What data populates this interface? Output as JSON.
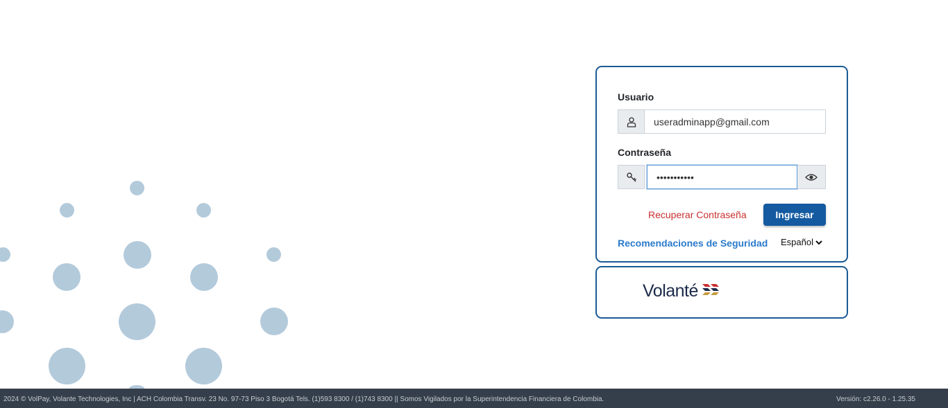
{
  "login": {
    "username_label": "Usuario",
    "username_value": "useradminapp@gmail.com",
    "password_label": "Contraseña",
    "password_value": "•••••••••••",
    "recover_link": "Recuperar Contraseña",
    "submit_label": "Ingresar",
    "security_link": "Recomendaciones de Seguridad",
    "language": "Español",
    "icons": {
      "username": "user-icon",
      "password": "key-icon",
      "toggle": "eye-icon",
      "language": "chevron-down-icon"
    }
  },
  "brand": {
    "logo_text": "Volanté",
    "colors": {
      "primary": "#145aa0",
      "border": "#1a5a93",
      "link_red": "#c8302f",
      "link_blue": "#2a7acb"
    }
  },
  "footer": {
    "text": "2024 © VolPay, Volante Technologies, Inc | ACH Colombia Transv. 23 No. 97-73 Piso 3 Bogotá Tels. (1)593 8300 / (1)743 8300 || Somos Vigilados por la Superintendencia Financiera de Colombia.",
    "version": "Versión: c2.26.0 - 1.25.35"
  }
}
